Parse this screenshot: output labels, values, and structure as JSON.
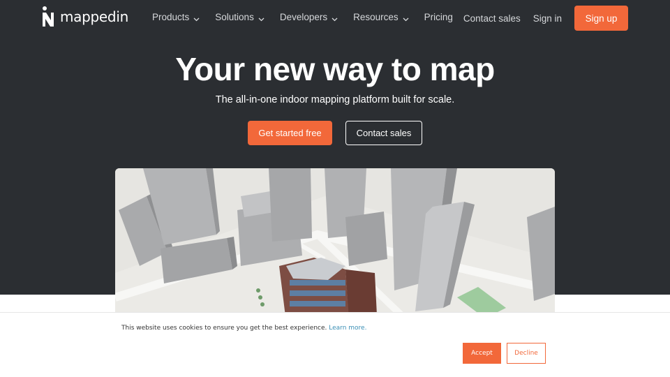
{
  "brand": {
    "name": "mappedin",
    "accent": "#f2683a",
    "hero_bg": "#2b2e32"
  },
  "nav": {
    "items": [
      {
        "label": "Products",
        "icon": "chevron-down-icon"
      },
      {
        "label": "Solutions",
        "icon": "chevron-down-icon"
      },
      {
        "label": "Developers",
        "icon": "chevron-down-icon"
      },
      {
        "label": "Resources",
        "icon": "chevron-down-icon"
      },
      {
        "label": "Pricing"
      }
    ],
    "contact_sales": "Contact sales",
    "sign_in": "Sign in",
    "sign_up": "Sign up"
  },
  "hero": {
    "headline": "Your new way to map",
    "subhead": "The all-in-one indoor mapping platform built for scale.",
    "primary_cta": "Get started free",
    "secondary_cta": "Contact sales"
  },
  "cookie": {
    "message": "This website uses cookies to ensure you get the best experience.",
    "learn_more": "Learn more.",
    "accept": "Accept",
    "decline": "Decline"
  }
}
